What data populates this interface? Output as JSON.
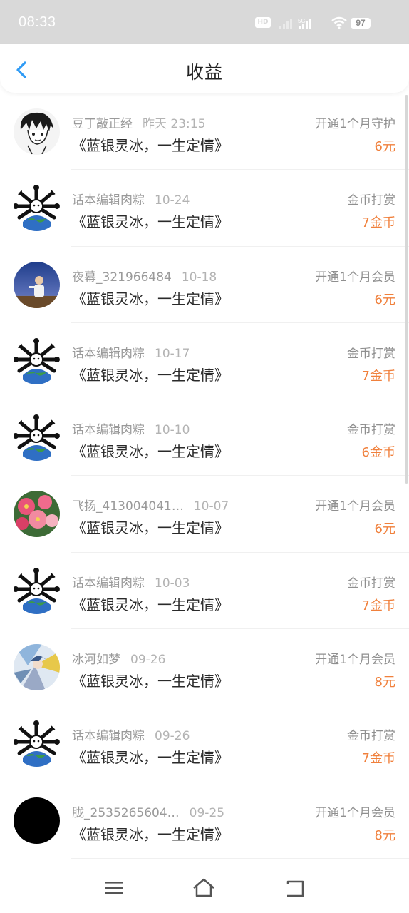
{
  "status_bar": {
    "time": "08:33",
    "battery": "97",
    "hd_label": "HD",
    "network": "5G"
  },
  "header": {
    "title": "收益"
  },
  "records": [
    {
      "user": "豆丁敲正经",
      "date": "昨天 23:15",
      "book": "《蓝银灵冰，一生定情》",
      "type": "开通1个月守护",
      "amount": "6元",
      "avatar": "sketch-boy"
    },
    {
      "user": "话本编辑肉粽",
      "date": "10-24",
      "book": "《蓝银灵冰，一生定情》",
      "type": "金币打赏",
      "amount": "7金币",
      "avatar": "bones-globe"
    },
    {
      "user": "夜幕_321966484",
      "date": "10-18",
      "book": "《蓝银灵冰，一生定情》",
      "type": "开通1个月会员",
      "amount": "6元",
      "avatar": "night-photo"
    },
    {
      "user": "话本编辑肉粽",
      "date": "10-17",
      "book": "《蓝银灵冰，一生定情》",
      "type": "金币打赏",
      "amount": "7金币",
      "avatar": "bones-globe"
    },
    {
      "user": "话本编辑肉粽",
      "date": "10-10",
      "book": "《蓝银灵冰，一生定情》",
      "type": "金币打赏",
      "amount": "6金币",
      "avatar": "bones-globe"
    },
    {
      "user": "飞扬_413004041…",
      "date": "10-07",
      "book": "《蓝银灵冰，一生定情》",
      "type": "开通1个月会员",
      "amount": "6元",
      "avatar": "flowers"
    },
    {
      "user": "话本编辑肉粽",
      "date": "10-03",
      "book": "《蓝银灵冰，一生定情》",
      "type": "金币打赏",
      "amount": "7金币",
      "avatar": "bones-globe"
    },
    {
      "user": "冰河如梦",
      "date": "09-26",
      "book": "《蓝银灵冰，一生定情》",
      "type": "开通1个月会员",
      "amount": "8元",
      "avatar": "anime"
    },
    {
      "user": "话本编辑肉粽",
      "date": "09-26",
      "book": "《蓝银灵冰，一生定情》",
      "type": "金币打赏",
      "amount": "7金币",
      "avatar": "bones-globe"
    },
    {
      "user": "胧_2535265604…",
      "date": "09-25",
      "book": "《蓝银灵冰，一生定情》",
      "type": "开通1个月会员",
      "amount": "8元",
      "avatar": "black"
    }
  ],
  "colors": {
    "accent": "#2f9bf5",
    "amount": "#f0803c",
    "status_bar": "#d9d9d9"
  }
}
